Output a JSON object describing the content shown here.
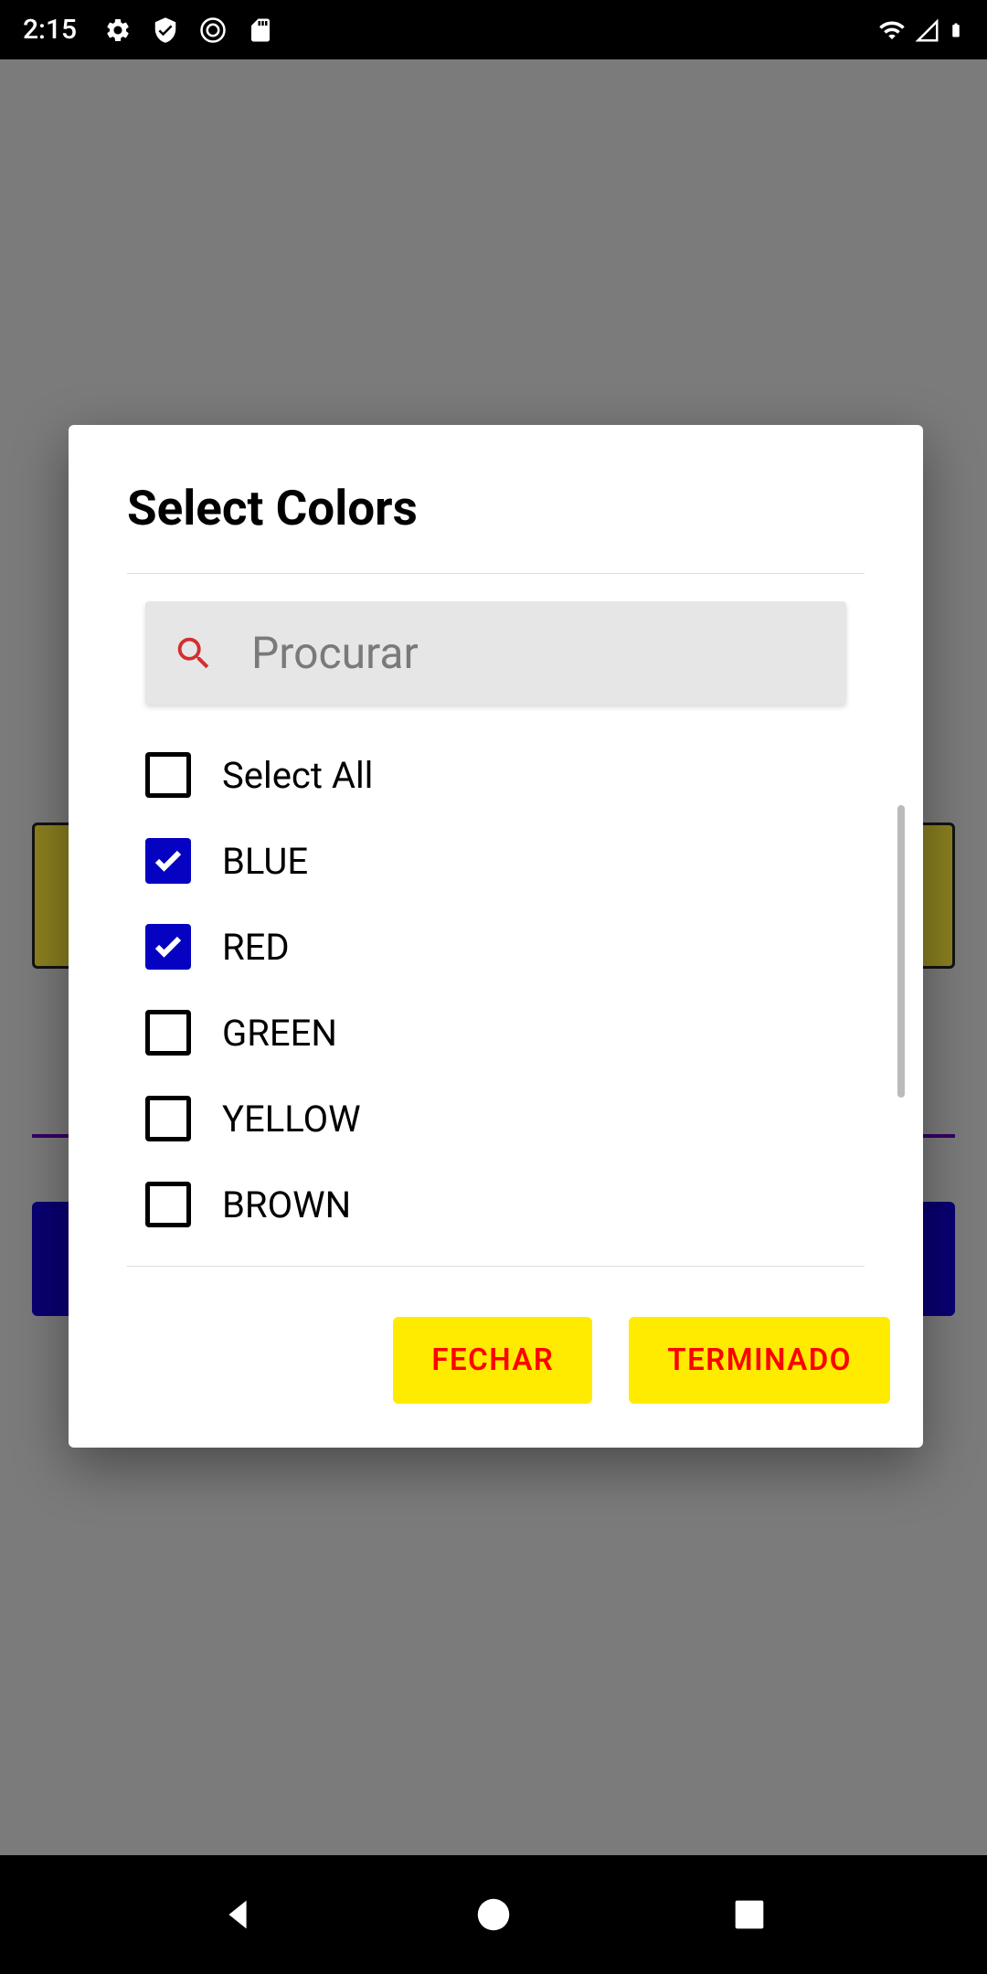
{
  "status_bar": {
    "time": "2:15"
  },
  "dialog": {
    "title": "Select Colors",
    "search": {
      "placeholder": "Procurar"
    },
    "select_all_label": "Select All",
    "items": [
      {
        "label": "BLUE",
        "checked": true
      },
      {
        "label": "RED",
        "checked": true
      },
      {
        "label": "GREEN",
        "checked": false
      },
      {
        "label": "YELLOW",
        "checked": false
      },
      {
        "label": "BROWN",
        "checked": false
      }
    ],
    "actions": {
      "close": "FECHAR",
      "done": "TERMINADO"
    }
  }
}
